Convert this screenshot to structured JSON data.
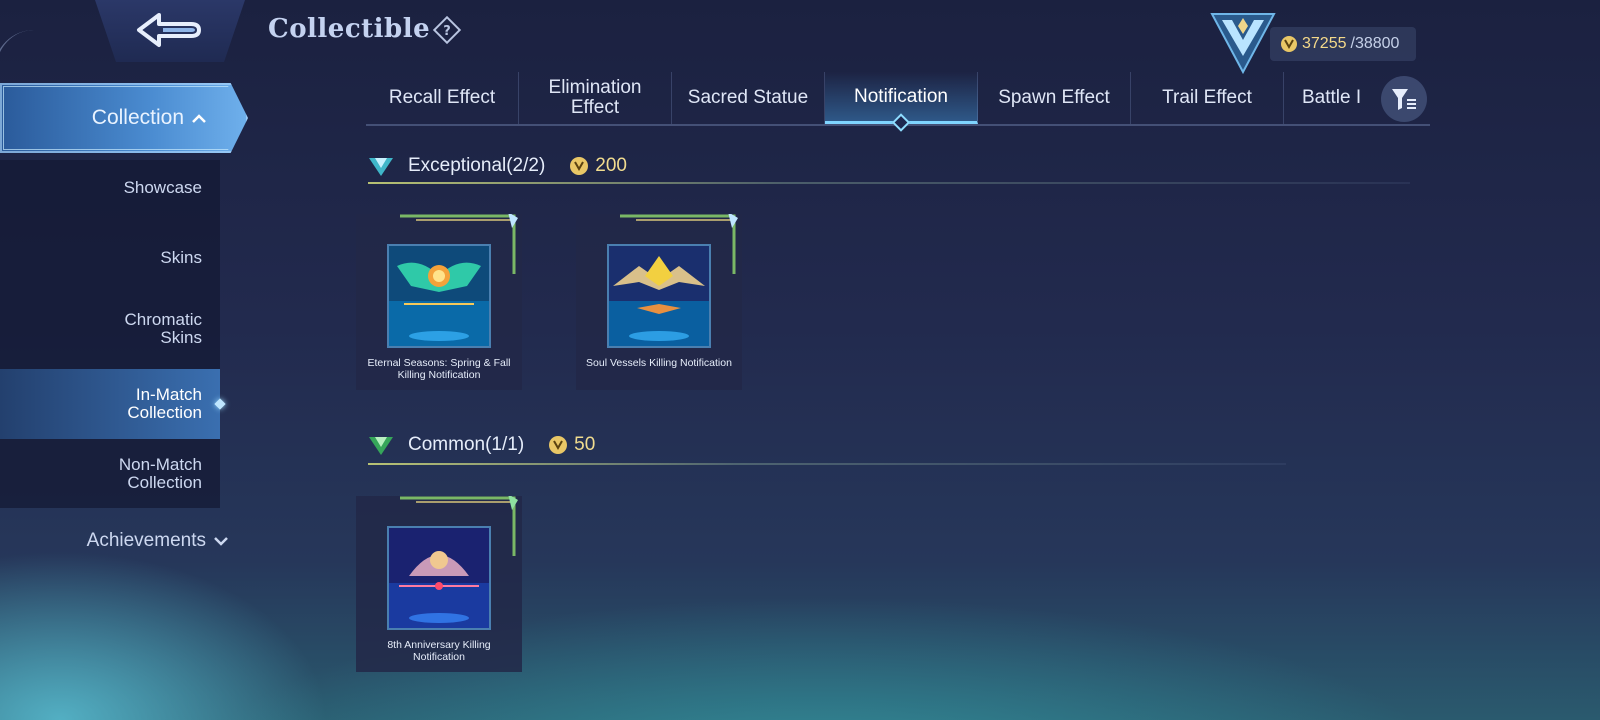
{
  "header": {
    "title": "Collectible"
  },
  "currency": {
    "current": "37255",
    "max": "/38800",
    "icon": "coin-icon"
  },
  "sidebar": {
    "group_label": "Collection",
    "items": [
      {
        "label": "Showcase"
      },
      {
        "label": "Skins"
      },
      {
        "label": "Chromatic Skins"
      },
      {
        "label": "In-Match Collection",
        "active": true
      },
      {
        "label": "Non-Match Collection"
      }
    ],
    "achievements_label": "Achievements"
  },
  "tabs": [
    {
      "label": "Recall Effect"
    },
    {
      "label": "Elimination Effect"
    },
    {
      "label": "Sacred Statue"
    },
    {
      "label": "Notification",
      "active": true
    },
    {
      "label": "Spawn Effect"
    },
    {
      "label": "Trail Effect"
    },
    {
      "label": "Battle I"
    }
  ],
  "sections": [
    {
      "title": "Exceptional(2/2)",
      "price": "200",
      "items": [
        {
          "name": "Eternal Seasons: Spring & Fall Killing Notification"
        },
        {
          "name": "Soul Vessels Killing Notification"
        }
      ]
    },
    {
      "title": "Common(1/1)",
      "price": "50",
      "items": [
        {
          "name": "8th Anniversary Killing Notification"
        }
      ]
    }
  ],
  "colors": {
    "accent": "#7fd4ff",
    "gold": "#f1dc8f",
    "sidebar_active": "#3a6fb0"
  }
}
